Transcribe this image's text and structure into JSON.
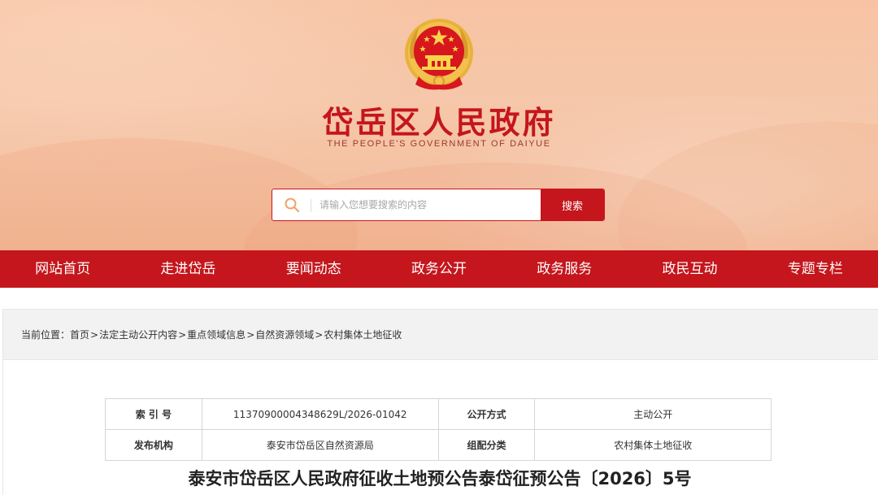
{
  "header": {
    "title": "岱岳区人民政府",
    "subtitle": "THE PEOPLE'S GOVERNMENT OF DAIYUE",
    "emblem_icon": "national-emblem-icon"
  },
  "search": {
    "placeholder": "请输入您想要搜索的内容",
    "button_label": "搜索",
    "icon": "search-icon"
  },
  "nav": {
    "items": [
      {
        "label": "网站首页"
      },
      {
        "label": "走进岱岳"
      },
      {
        "label": "要闻动态"
      },
      {
        "label": "政务公开"
      },
      {
        "label": "政务服务"
      },
      {
        "label": "政民互动"
      },
      {
        "label": "专题专栏"
      }
    ]
  },
  "breadcrumb": {
    "prefix": "当前位置：",
    "items": [
      "首页",
      "法定主动公开内容",
      "重点领域信息",
      "自然资源领域",
      "农村集体土地征收"
    ],
    "separator": ">"
  },
  "meta": {
    "rows": [
      {
        "label1": "索 引 号",
        "value1": "11370900004348629L/2026-01042",
        "label2": "公开方式",
        "value2": "主动公开"
      },
      {
        "label1": "发布机构",
        "value1": "泰安市岱岳区自然资源局",
        "label2": "组配分类",
        "value2": "农村集体土地征收"
      }
    ]
  },
  "article": {
    "title": "泰安市岱岳区人民政府征收土地预公告泰岱征预公告〔2026〕5号"
  },
  "colors": {
    "brand_red": "#c4161c",
    "header_bg": "#f6c5a8",
    "emblem_gold": "#f2c14e"
  }
}
